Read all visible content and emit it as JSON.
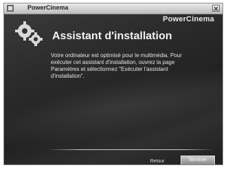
{
  "window": {
    "title": "PowerCinema"
  },
  "brand": {
    "logo": "PowerCinema"
  },
  "icons": {
    "gears": "gears-icon"
  },
  "wizard": {
    "heading": "Assistant d'installation",
    "message": "Votre ordinateur est optimisé pour le multimédia. Pour exécuter cet assistant d'installation, ouvrez la page Paramètres et sélectionnez \"Exécuter l'assistant d'installation\"."
  },
  "buttons": {
    "back": "Retour",
    "finish": "Terminer"
  }
}
